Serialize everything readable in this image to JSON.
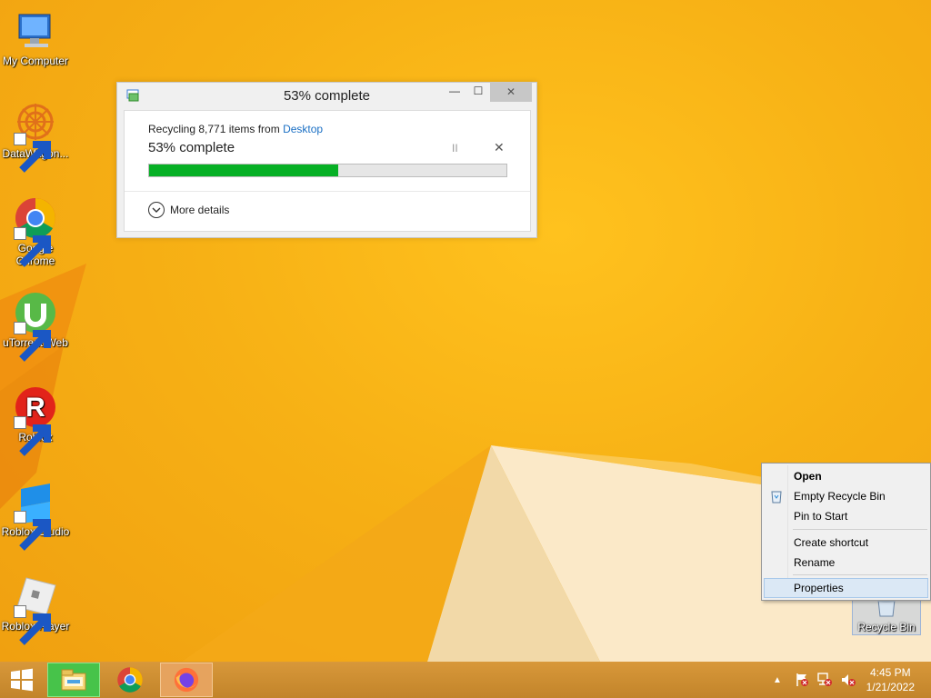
{
  "desktop": {
    "icons": [
      {
        "label": "My Computer"
      },
      {
        "label": "DataWagon..."
      },
      {
        "label": "Google Chrome"
      },
      {
        "label": "uTorrent Web"
      },
      {
        "label": "Roblox"
      },
      {
        "label": "Roblox Studio"
      },
      {
        "label": "Roblox Player"
      }
    ],
    "recycle_bin_label": "Recycle Bin"
  },
  "progress_dialog": {
    "title": "53% complete",
    "recycling_prefix": "Recycling 8,771 items from ",
    "source_link": "Desktop",
    "status": "53% complete",
    "progress_percent": 53,
    "more_details": "More details",
    "pause_glyph": "II",
    "cancel_glyph": "✕",
    "minimize_glyph": "—",
    "maximize_glyph": "☐",
    "close_glyph": "✕"
  },
  "context_menu": {
    "items": [
      {
        "label": "Open"
      },
      {
        "label": "Empty Recycle Bin"
      },
      {
        "label": "Pin to Start"
      },
      {
        "label": "Create shortcut"
      },
      {
        "label": "Rename"
      },
      {
        "label": "Properties"
      }
    ],
    "hovered": "Properties"
  },
  "taskbar": {
    "clock_time": "4:45 PM",
    "clock_date": "1/21/2022",
    "apps": [
      "file-explorer",
      "google-chrome",
      "firefox"
    ]
  },
  "colors": {
    "progress_fill": "#06b025",
    "link": "#1a6fc4",
    "wallpaper": "#f7b417"
  }
}
